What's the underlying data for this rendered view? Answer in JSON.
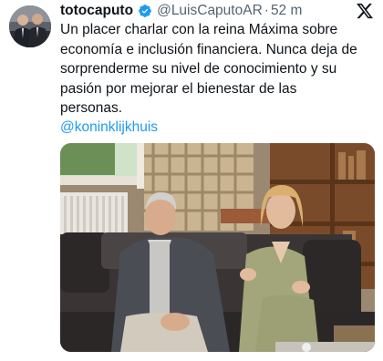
{
  "tweet": {
    "display_name": "totocaputo",
    "handle": "@LuisCaputoAR",
    "separator": "·",
    "time": "52 m",
    "text_lines": [
      "Un placer charlar con la reina Máxima sobre",
      "economía e inclusión financiera. Nunca deja de",
      "sorprenderme su nivel de conocimiento y su",
      "pasión por mejorar el bienestar de las",
      "personas."
    ],
    "mention": "@koninklijkhuis"
  },
  "icons": {
    "verified": "verified-badge-icon",
    "platform": "x-logo-icon"
  },
  "colors": {
    "link": "#1d9bf0",
    "verified": "#1d9bf0",
    "secondary_text": "#536471",
    "primary_text": "#0f1419"
  }
}
